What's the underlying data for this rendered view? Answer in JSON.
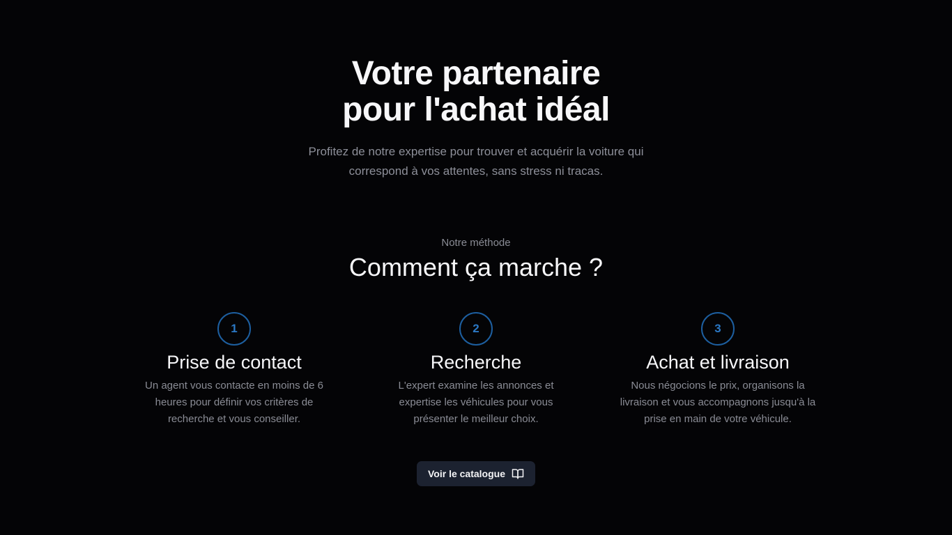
{
  "hero": {
    "title_line_1": "Votre partenaire",
    "title_line_2": "pour l'achat idéal",
    "subtitle": "Profitez de notre expertise pour trouver et acquérir la voiture qui correspond à vos attentes, sans stress ni tracas."
  },
  "method": {
    "eyebrow": "Notre méthode",
    "title": "Comment ça marche ?"
  },
  "steps": [
    {
      "number": "1",
      "title": "Prise de contact",
      "text": "Un agent vous contacte en moins de 6 heures pour définir vos critères de recherche et vous conseiller."
    },
    {
      "number": "2",
      "title": "Recherche",
      "text": "L'expert examine les annonces et expertise les véhicules pour vous présenter le meilleur choix."
    },
    {
      "number": "3",
      "title": "Achat et livraison",
      "text": "Nous négocions le prix, organisons la livraison et vous accompagnons jusqu'à la prise en main de votre véhicule."
    }
  ],
  "cta": {
    "label": "Voir le catalogue",
    "icon": "book-open-icon"
  },
  "colors": {
    "background": "#040406",
    "accent": "#2b78c5",
    "muted_text": "#8a8c95",
    "button_background": "#1c2230"
  }
}
